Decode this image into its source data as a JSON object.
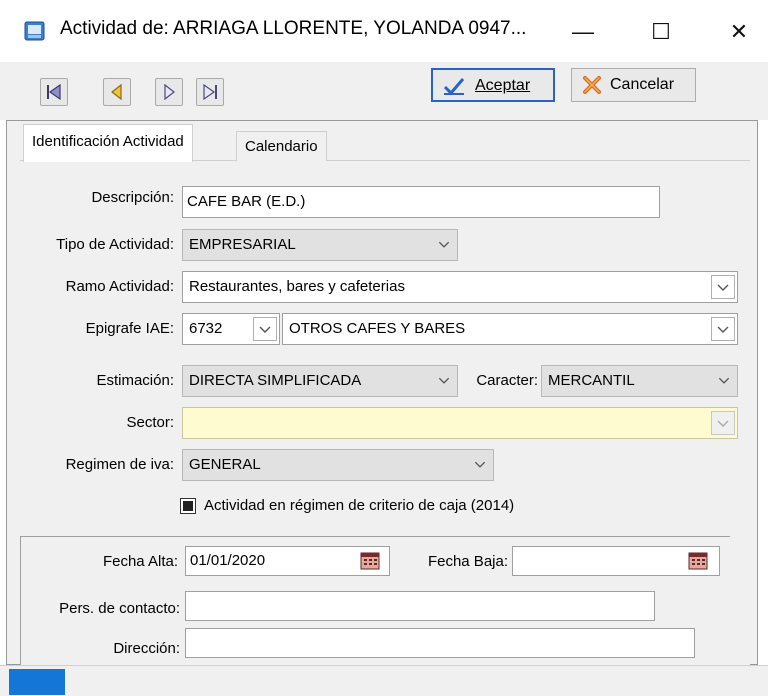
{
  "window": {
    "title": "Actividad de: ARRIAGA LLORENTE, YOLANDA 0947...",
    "minimize_glyph": "—",
    "maximize_glyph": "☐",
    "close_glyph": "✕"
  },
  "toolbar": {
    "nav_icons": [
      "first-record-icon",
      "previous-record-icon",
      "next-record-icon",
      "last-record-icon"
    ],
    "accept_label": "Aceptar",
    "cancel_label": "Cancelar"
  },
  "tabs": [
    {
      "label": "Identificación Actividad",
      "active": true
    },
    {
      "label": "Calendario",
      "active": false
    }
  ],
  "form": {
    "descripcion_label": "Descripción:",
    "descripcion_value": "CAFE BAR (E.D.)",
    "tipo_label": "Tipo de Actividad:",
    "tipo_value": "EMPRESARIAL",
    "ramo_label": "Ramo Actividad:",
    "ramo_value": "Restaurantes, bares y cafeterias",
    "epigrafe_label": "Epigrafe IAE:",
    "epigrafe_code": "6732",
    "epigrafe_desc": "OTROS CAFES Y BARES",
    "estimacion_label": "Estimación:",
    "estimacion_value": "DIRECTA SIMPLIFICADA",
    "caracter_label": "Caracter:",
    "caracter_value": "MERCANTIL",
    "sector_label": "Sector:",
    "sector_value": "",
    "iva_label": "Regimen de iva:",
    "iva_value": "GENERAL",
    "criterio_caja_label": "Actividad en régimen de criterio de caja (2014)",
    "criterio_caja_checked": true,
    "fecha_alta_label": "Fecha Alta:",
    "fecha_alta_value": "01/01/2020",
    "fecha_baja_label": "Fecha Baja:",
    "fecha_baja_value": "",
    "contacto_label": "Pers. de contacto:",
    "contacto_value": "",
    "direccion_label": "Dirección:",
    "direccion_value": ""
  },
  "colors": {
    "sector_bg": "#fffbd0",
    "status_accent": "#1476d6",
    "accept_check": "#2a62c9",
    "cancel_x": "#d86a1a"
  }
}
